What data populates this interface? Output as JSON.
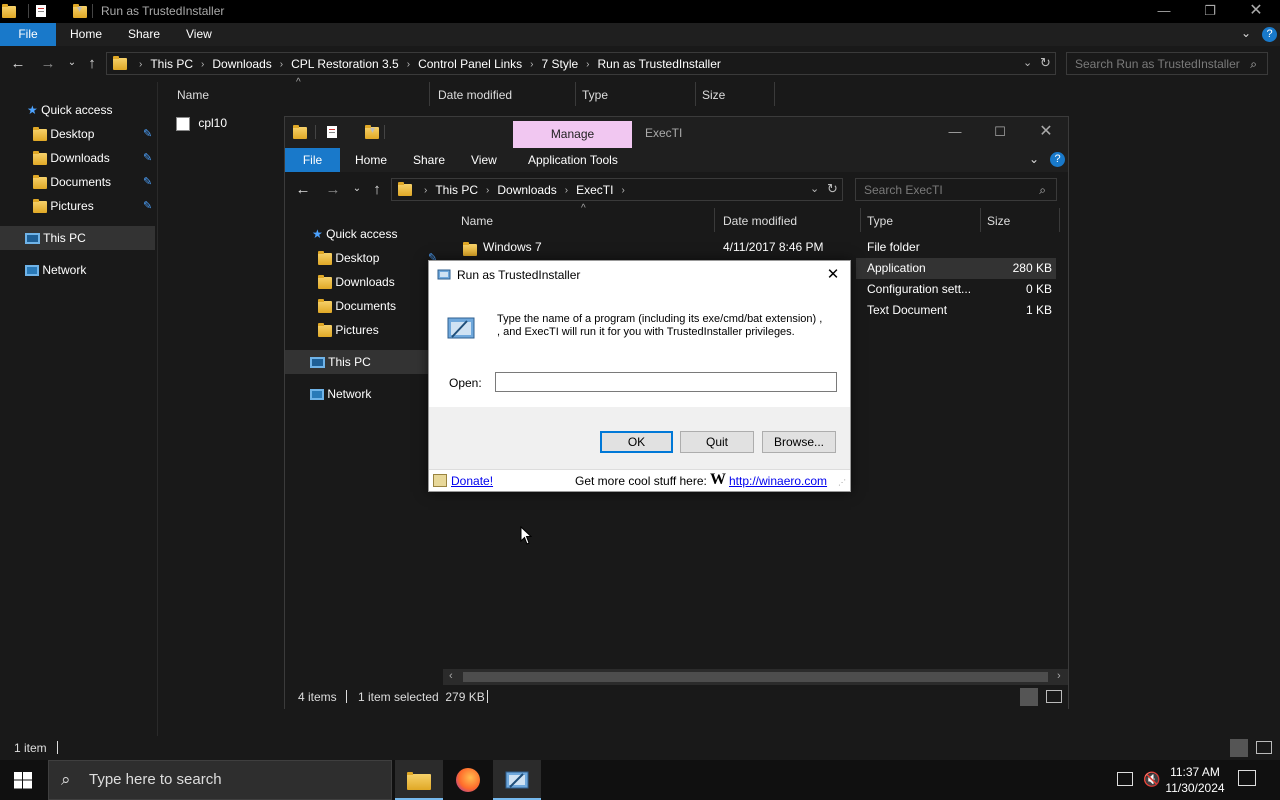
{
  "bg": {
    "title": "Run as TrustedInstaller",
    "ribbon_tabs": [
      "File",
      "Home",
      "Share",
      "View"
    ],
    "breadcrumbs": [
      "This PC",
      "Downloads",
      "CPL Restoration 3.5",
      "Control Panel Links",
      "7 Style",
      "Run as TrustedInstaller"
    ],
    "search_placeholder": "Search Run as TrustedInstaller",
    "nav": {
      "quick_access": "Quick access",
      "pinned": [
        "Desktop",
        "Downloads",
        "Documents",
        "Pictures"
      ],
      "this_pc": "This PC",
      "network": "Network"
    },
    "columns": [
      "Name",
      "Date modified",
      "Type",
      "Size"
    ],
    "files": [
      {
        "name": "cpl10"
      }
    ],
    "status": "1 item"
  },
  "fg": {
    "manage_tab": "Manage",
    "title": "ExecTI",
    "ribbon_tabs": [
      "File",
      "Home",
      "Share",
      "View",
      "Application Tools"
    ],
    "breadcrumbs": [
      "This PC",
      "Downloads",
      "ExecTI"
    ],
    "search_placeholder": "Search ExecTI",
    "nav": {
      "quick_access": "Quick access",
      "pinned": [
        "Desktop",
        "Downloads",
        "Documents",
        "Pictures"
      ],
      "this_pc": "This PC",
      "network": "Network"
    },
    "columns": [
      "Name",
      "Date modified",
      "Type",
      "Size"
    ],
    "files": [
      {
        "name": "Windows 7",
        "date": "4/11/2017 8:46 PM",
        "type": "File folder",
        "size": ""
      },
      {
        "name": "",
        "date": "",
        "type": "Application",
        "size": "280 KB"
      },
      {
        "name": "",
        "date": "",
        "type": "Configuration sett...",
        "size": "0 KB"
      },
      {
        "name": "",
        "date": "",
        "type": "Text Document",
        "size": "1 KB"
      }
    ],
    "status": {
      "items": "4 items",
      "selected": "1 item selected  279 KB"
    }
  },
  "dialog": {
    "title": "Run as TrustedInstaller",
    "message_line1": "Type the name of a program (including its exe/cmd/bat extension) ,",
    "message_line2": ", and ExecTI will run it for you with TrustedInstaller privileges.",
    "open_label": "Open:",
    "open_value": "",
    "ok": "OK",
    "quit": "Quit",
    "browse": "Browse...",
    "donate": "Donate!",
    "footer_text": "Get more cool stuff here:",
    "footer_logo": "W",
    "url": "http://winaero.com"
  },
  "taskbar": {
    "search_placeholder": "Type here to search",
    "time": "11:37 AM",
    "date": "11/30/2024"
  },
  "colors": {
    "accent": "#1979ca",
    "manage_tab": "#f1c7f1",
    "link": "#0000ee"
  }
}
